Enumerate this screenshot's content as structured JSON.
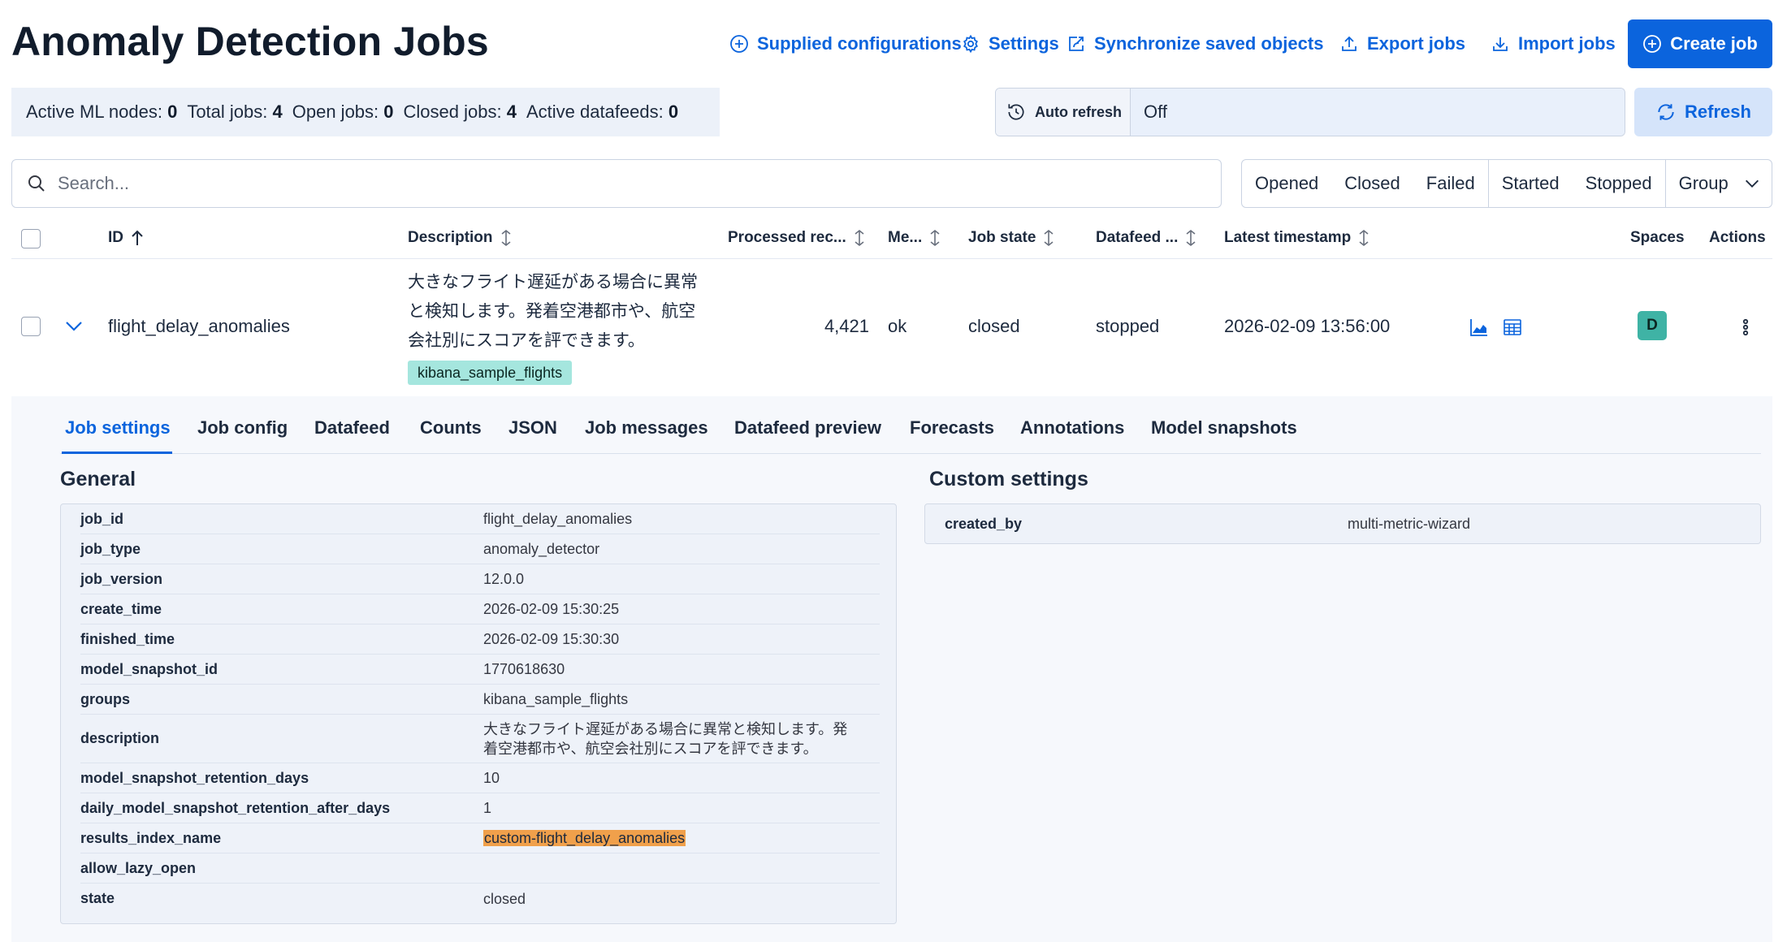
{
  "page": {
    "title": "Anomaly Detection Jobs"
  },
  "header_actions": {
    "supplied_configurations": "Supplied configurations",
    "settings": "Settings",
    "synchronize": "Synchronize saved objects",
    "export": "Export jobs",
    "import": "Import jobs",
    "create": "Create job"
  },
  "stats": [
    {
      "label": "Active ML nodes:",
      "value": "0"
    },
    {
      "label": "Total jobs:",
      "value": "4"
    },
    {
      "label": "Open jobs:",
      "value": "0"
    },
    {
      "label": "Closed jobs:",
      "value": "4"
    },
    {
      "label": "Active datafeeds:",
      "value": "0"
    }
  ],
  "auto_refresh": {
    "label": "Auto refresh",
    "value": "Off"
  },
  "refresh_button": "Refresh",
  "search": {
    "placeholder": "Search...",
    "value": ""
  },
  "filters": {
    "state": [
      "Opened",
      "Closed",
      "Failed"
    ],
    "datafeed": [
      "Started",
      "Stopped"
    ],
    "group": "Group"
  },
  "table": {
    "columns": {
      "id": "ID",
      "description": "Description",
      "processed": "Processed rec...",
      "memory": "Me...",
      "job_state": "Job state",
      "datafeed": "Datafeed ...",
      "latest": "Latest timestamp",
      "spaces": "Spaces",
      "actions": "Actions"
    },
    "rows": [
      {
        "id": "flight_delay_anomalies",
        "description": "大きなフライト遅延がある場合に異常と検知します。発着空港都市や、航空会社別にスコアを評できます。",
        "group_badge": "kibana_sample_flights",
        "processed": "4,421",
        "memory": "ok",
        "job_state": "closed",
        "datafeed": "stopped",
        "latest": "2026-02-09 13:56:00",
        "space": "D"
      }
    ]
  },
  "tabs": [
    "Job settings",
    "Job config",
    "Datafeed",
    "Counts",
    "JSON",
    "Job messages",
    "Datafeed preview",
    "Forecasts",
    "Annotations",
    "Model snapshots"
  ],
  "general": {
    "title": "General",
    "rows": [
      {
        "key": "job_id",
        "value": "flight_delay_anomalies"
      },
      {
        "key": "job_type",
        "value": "anomaly_detector"
      },
      {
        "key": "job_version",
        "value": "12.0.0"
      },
      {
        "key": "create_time",
        "value": "2026-02-09 15:30:25"
      },
      {
        "key": "finished_time",
        "value": "2026-02-09 15:30:30"
      },
      {
        "key": "model_snapshot_id",
        "value": "1770618630"
      },
      {
        "key": "groups",
        "value": "kibana_sample_flights"
      },
      {
        "key": "description",
        "value": "大きなフライト遅延がある場合に異常と検知します。発着空港都市や、航空会社別にスコアを評できます。"
      },
      {
        "key": "model_snapshot_retention_days",
        "value": "10"
      },
      {
        "key": "daily_model_snapshot_retention_after_days",
        "value": "1"
      },
      {
        "key": "results_index_name",
        "value": "custom-flight_delay_anomalies"
      },
      {
        "key": "allow_lazy_open",
        "value": ""
      },
      {
        "key": "state",
        "value": "closed"
      }
    ]
  },
  "custom_settings": {
    "title": "Custom settings",
    "rows": [
      {
        "key": "created_by",
        "value": "multi-metric-wizard"
      }
    ]
  },
  "colors": {
    "primary": "#0b64dd",
    "highlight": "#f0a04b",
    "badge": "#a5e6de",
    "space_avatar": "#3fb3a5"
  }
}
